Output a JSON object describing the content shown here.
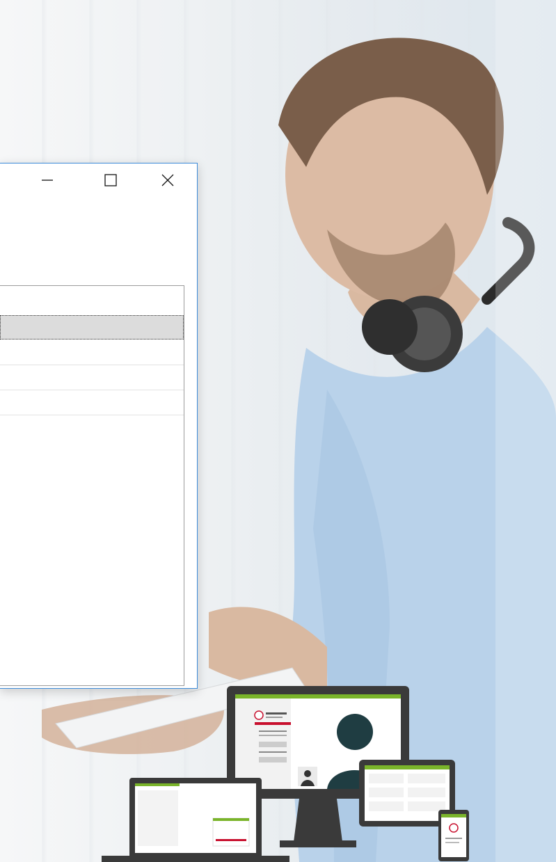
{
  "window": {
    "title": "",
    "controls": {
      "minimize": "minimize-icon",
      "maximize": "maximize-icon",
      "close": "close-icon"
    },
    "accent_color": "#3c8ad8"
  },
  "list": {
    "rows": [
      "",
      "",
      "",
      ""
    ],
    "selected_index": 0
  },
  "devices_illustration": {
    "accent_color": "#7ab42a",
    "highlight_color": "#c8102e"
  }
}
